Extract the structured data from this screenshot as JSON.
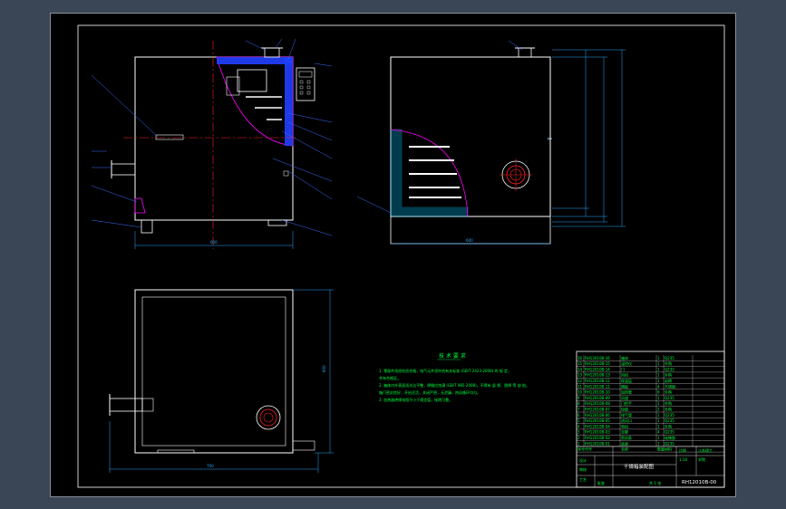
{
  "colors": {
    "background": "#3a4655",
    "sheet": "#000000",
    "outline": "#ffffff",
    "centerline": "#ff2020",
    "leader": "#3b6cff",
    "dimension": "#2ba8ff",
    "insulation": "#00c8ff",
    "heater_zone": "#ff00ff",
    "notes": "#00ff40",
    "titleblock": "#ffffff"
  },
  "drawing": {
    "type": "cad-assembly-drawing",
    "views": [
      "front-view",
      "side-view",
      "top-view"
    ]
  },
  "notes": {
    "heading": "技 术 要 求",
    "lines": [
      "1. 零部件须经检验合格，电气元件须符合有关标准 (GB/T 2423-2008) 的 规 定，",
      "   并有合格证。",
      "2. 箱体内外表面须光洁平整，焊缝应饱满 (GB/T 985-2008)，不得有 虚 焊、脱焊 等 缺 陷。",
      "   箱门密封良好，开启灵活，关闭严密，无泄漏，热风循环均匀。",
      "3. 加热器绝缘电阻不小于规定值，接地可靠。"
    ]
  },
  "title_block": {
    "drawing_title": "干燥箱装配图",
    "drawing_number": "RH12010B-00",
    "company_lines": [
      "江苏理工",
      "学院"
    ],
    "parts": [
      {
        "no": "16",
        "code": "RH12010B-16",
        "name": "箱体",
        "qty": "1",
        "material": "Q235"
      },
      {
        "no": "15",
        "code": "RH12010B-15",
        "name": "温控仪",
        "qty": "1",
        "material": "外购"
      },
      {
        "no": "14",
        "code": "RH12010B-14",
        "name": "门",
        "qty": "1",
        "material": "Q235"
      },
      {
        "no": "13",
        "code": "RH12010B-13",
        "name": "风机",
        "qty": "1",
        "material": "外购"
      },
      {
        "no": "12",
        "code": "RH12010B-12",
        "name": "保温层",
        "qty": "1",
        "material": "岩棉"
      },
      {
        "no": "11",
        "code": "RH12010B-11",
        "name": "隔板",
        "qty": "4",
        "material": "不锈钢"
      },
      {
        "no": "10",
        "code": "RH12010B-10",
        "name": "加热管",
        "qty": "6",
        "material": "外购"
      },
      {
        "no": "9",
        "code": "RH12010B-09",
        "name": "风道",
        "qty": "1",
        "material": "Q235"
      },
      {
        "no": "8",
        "code": "RH12010B-08",
        "name": "门把手",
        "qty": "1",
        "material": "外购"
      },
      {
        "no": "7",
        "code": "RH12010B-07",
        "name": "铰链",
        "qty": "2",
        "material": "外购"
      },
      {
        "no": "6",
        "code": "RH12010B-06",
        "name": "排气管",
        "qty": "1",
        "material": "Q235"
      },
      {
        "no": "5",
        "code": "RH12010B-05",
        "name": "进风口",
        "qty": "1",
        "material": "Q235"
      },
      {
        "no": "4",
        "code": "RH12010B-04",
        "name": "电机",
        "qty": "1",
        "material": "外购"
      },
      {
        "no": "3",
        "code": "RH12010B-03",
        "name": "支脚",
        "qty": "4",
        "material": "Q235"
      },
      {
        "no": "2",
        "code": "RH12010B-02",
        "name": "密封条",
        "qty": "1",
        "material": "硅橡胶"
      },
      {
        "no": "1",
        "code": "RH12010B-01",
        "name": "底座",
        "qty": "1",
        "material": "Q235"
      }
    ],
    "header_row": {
      "no": "序号",
      "code": "代号",
      "name": "名称",
      "qty": "数量",
      "material": "材料"
    },
    "sign_rows": [
      "设计",
      "审核",
      "工艺",
      "批准"
    ],
    "scale_label": "比例",
    "scale_value": "1:10",
    "sheet_label": "共 1 张"
  },
  "dimensions": {
    "front_width": "600",
    "side_width": "600",
    "top_width": "700",
    "top_height": "600"
  }
}
